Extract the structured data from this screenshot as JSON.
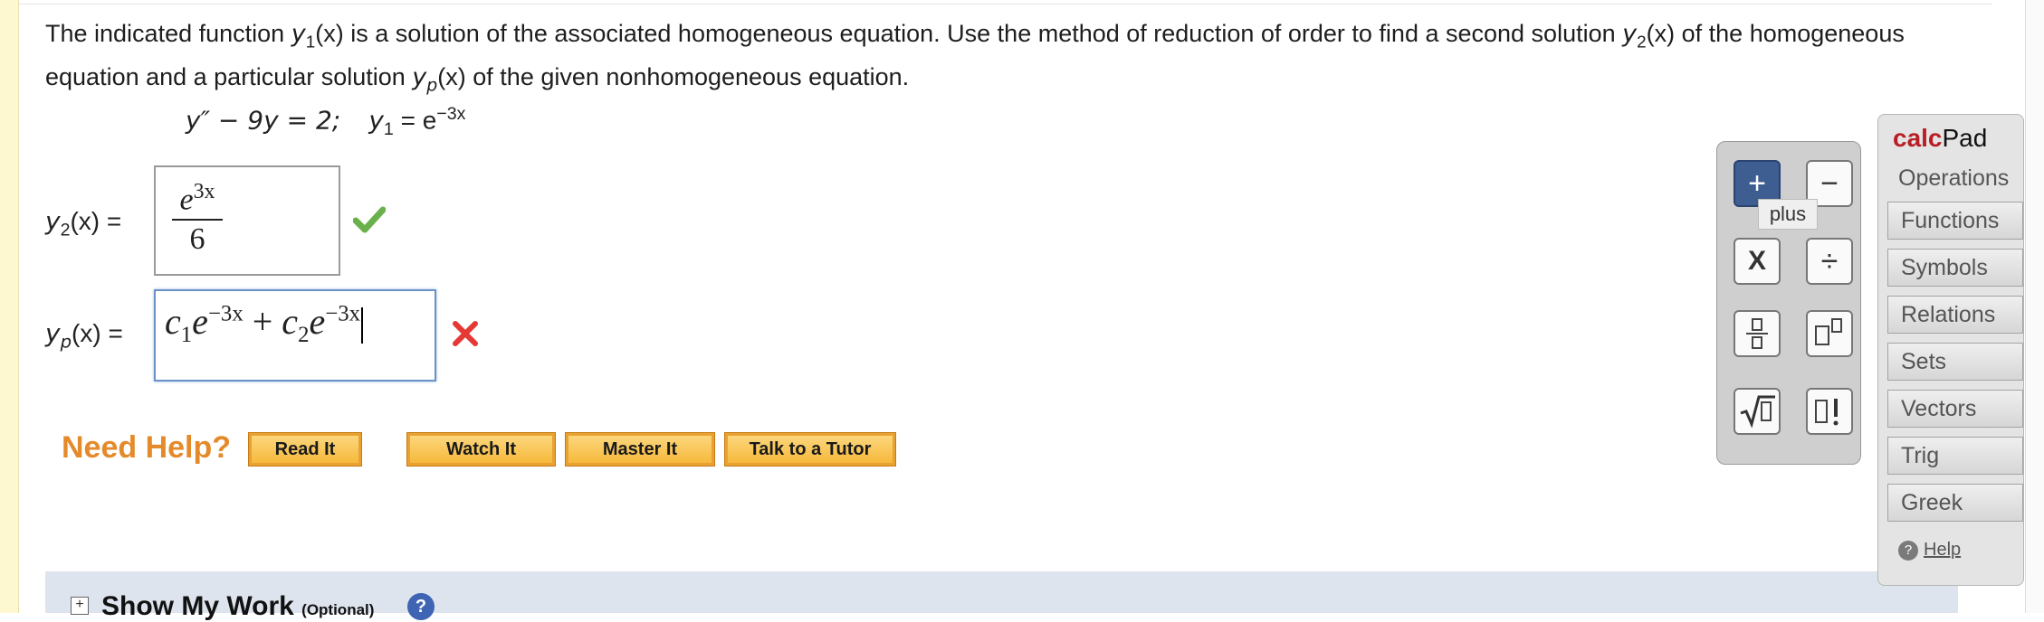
{
  "problem": {
    "text_before_y1": "The indicated function",
    "y1_var": "y",
    "y1_sub": "1",
    "y1_arg": "(x)",
    "text_after_y1": "is a solution of the associated homogeneous equation. Use the method of reduction of order to find a second solution",
    "y2_var": "y",
    "y2_sub": "2",
    "y2_arg": "(x)",
    "text_after_y2": "of the homogeneous equation and a particular solution",
    "yp_var": "y",
    "yp_sub": "p",
    "yp_arg": "(x)",
    "text_end": "of the given nonhomogeneous equation."
  },
  "equation": {
    "lhs": "y″ − 9y = 2;",
    "y1_label": "y",
    "y1_sub": "1",
    "y1_eq": "= e",
    "y1_exp": "−3x"
  },
  "answer_y2": {
    "label_var": "y",
    "label_sub": "2",
    "label_rest": "(x)  =",
    "numerator_base": "e",
    "numerator_exp": "3x",
    "denominator": "6",
    "status": "correct"
  },
  "answer_yp": {
    "label_var": "y",
    "label_sub": "p",
    "label_rest": "(x)  =",
    "c1": "c",
    "c1_sub": "1",
    "e1": "e",
    "e1_exp": "−3x",
    "plus": " + ",
    "c2": "c",
    "c2_sub": "2",
    "e2": "e",
    "e2_exp": "−3x",
    "status": "incorrect"
  },
  "help": {
    "label": "Need Help?",
    "buttons": [
      "Read It",
      "Watch It",
      "Master It",
      "Talk to a Tutor"
    ]
  },
  "show_my_work": {
    "toggle": "+",
    "title": "Show My Work",
    "optional": "(Optional)",
    "help_glyph": "?"
  },
  "calcpad": {
    "title_bold": "calc",
    "title_rest": "Pad",
    "active_tab": "Operations",
    "categories": [
      "Functions",
      "Symbols",
      "Relations",
      "Sets",
      "Vectors",
      "Trig",
      "Greek"
    ],
    "help": "Help",
    "help_glyph": "?",
    "tooltip": "plus",
    "buttons": [
      {
        "name": "plus",
        "glyph": "+",
        "active": true
      },
      {
        "name": "minus",
        "glyph": "−",
        "active": false
      },
      {
        "name": "times",
        "glyph": "X",
        "active": false
      },
      {
        "name": "divide",
        "glyph": "÷",
        "active": false
      },
      {
        "name": "fraction",
        "glyph": "▯/▯",
        "active": false
      },
      {
        "name": "exponent",
        "glyph": "▯▯",
        "active": false
      },
      {
        "name": "sqrt",
        "glyph": "√▯",
        "active": false
      },
      {
        "name": "factorial",
        "glyph": "▯!",
        "active": false
      }
    ]
  },
  "colors": {
    "correct": "#6ab04c",
    "incorrect": "#e53935",
    "accent_orange": "#e58a2a",
    "calcpad_red": "#b81e25",
    "active_button": "#3e5d91"
  }
}
